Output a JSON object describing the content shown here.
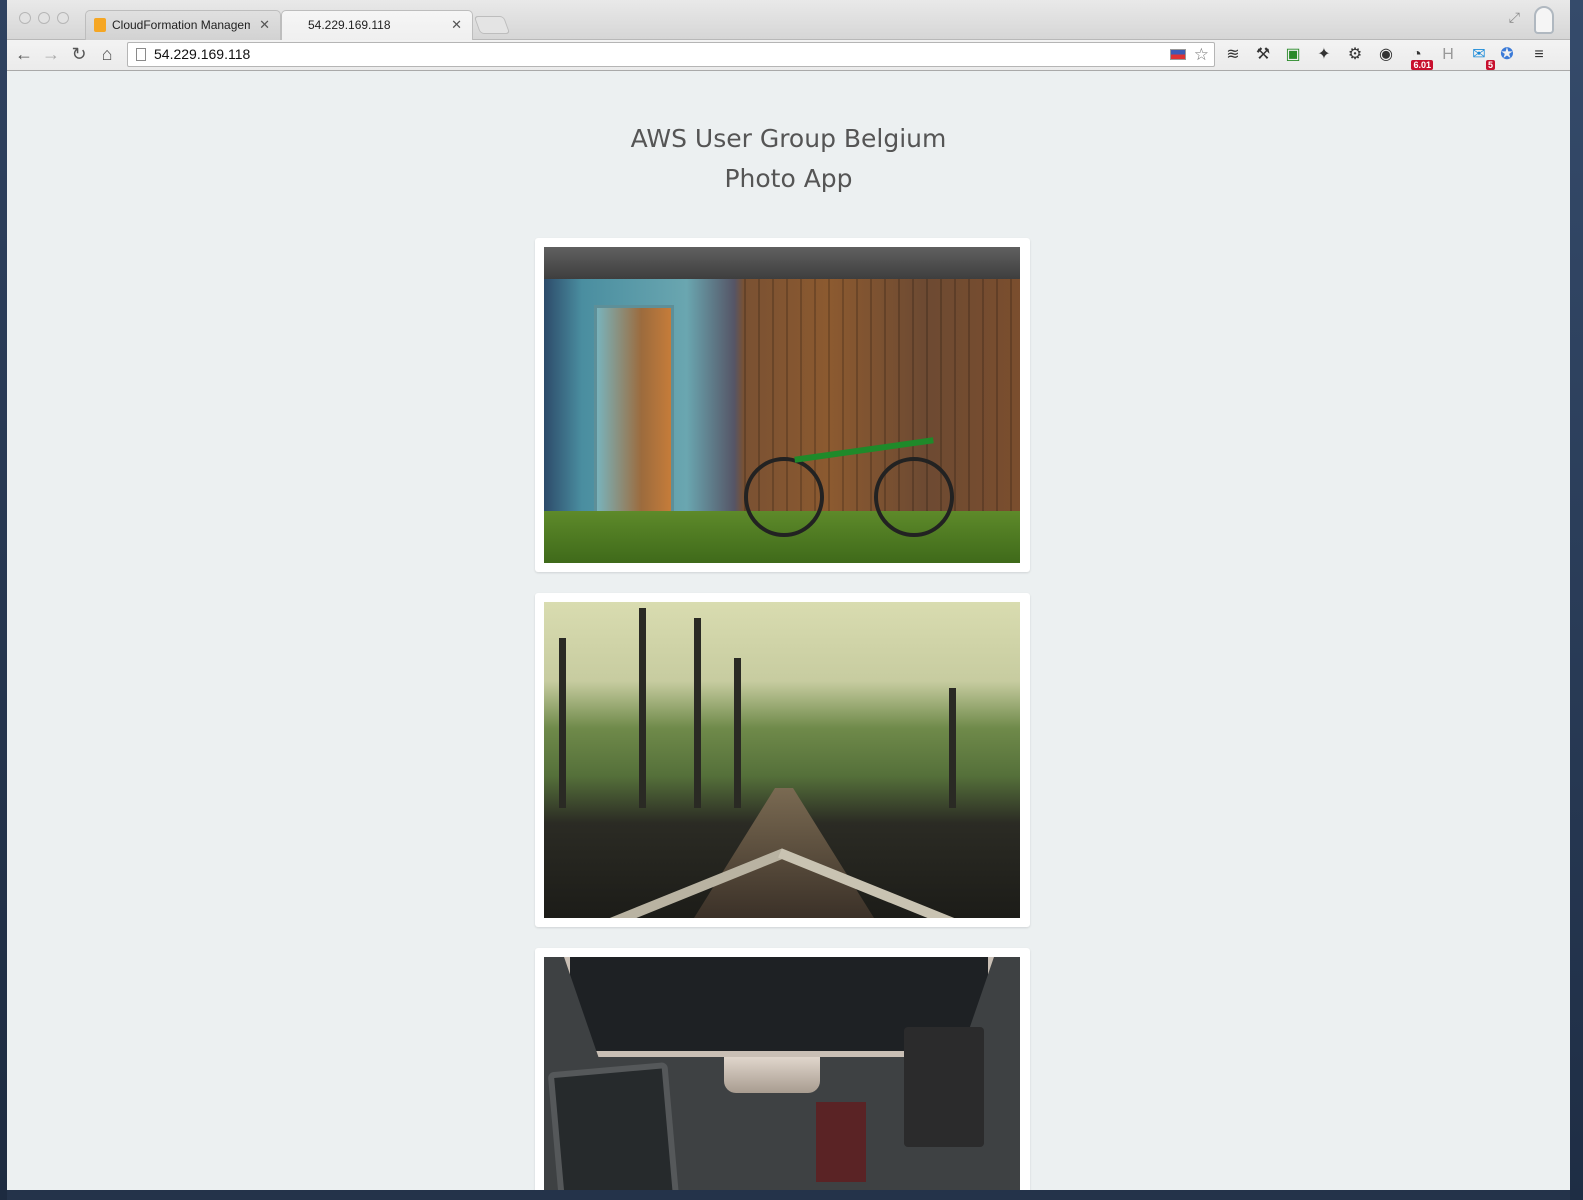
{
  "browser": {
    "tabs": [
      {
        "label": "CloudFormation Managem",
        "icon": "aws-cube-icon",
        "active": false
      },
      {
        "label": "54.229.169.118",
        "icon": "page-icon",
        "active": true
      }
    ],
    "url": "54.229.169.118",
    "extensions": [
      {
        "name": "buffer-icon"
      },
      {
        "name": "wrench-icon"
      },
      {
        "name": "evernote-icon"
      },
      {
        "name": "puzzle-icon"
      },
      {
        "name": "gear-icon"
      },
      {
        "name": "color-wheel-icon"
      },
      {
        "name": "speedometer-icon",
        "badge": "6.01"
      },
      {
        "name": "h-icon"
      },
      {
        "name": "mail-check-icon",
        "badge": "5"
      },
      {
        "name": "extension-icon"
      },
      {
        "name": "menu-icon"
      }
    ]
  },
  "page": {
    "title_line1": "AWS User Group Belgium",
    "title_line2": "Photo App"
  },
  "photos": [
    {
      "subject": "wooden shed with green bicycle"
    },
    {
      "subject": "railroad tracks"
    },
    {
      "subject": "desk with monitor and gadgets"
    }
  ]
}
